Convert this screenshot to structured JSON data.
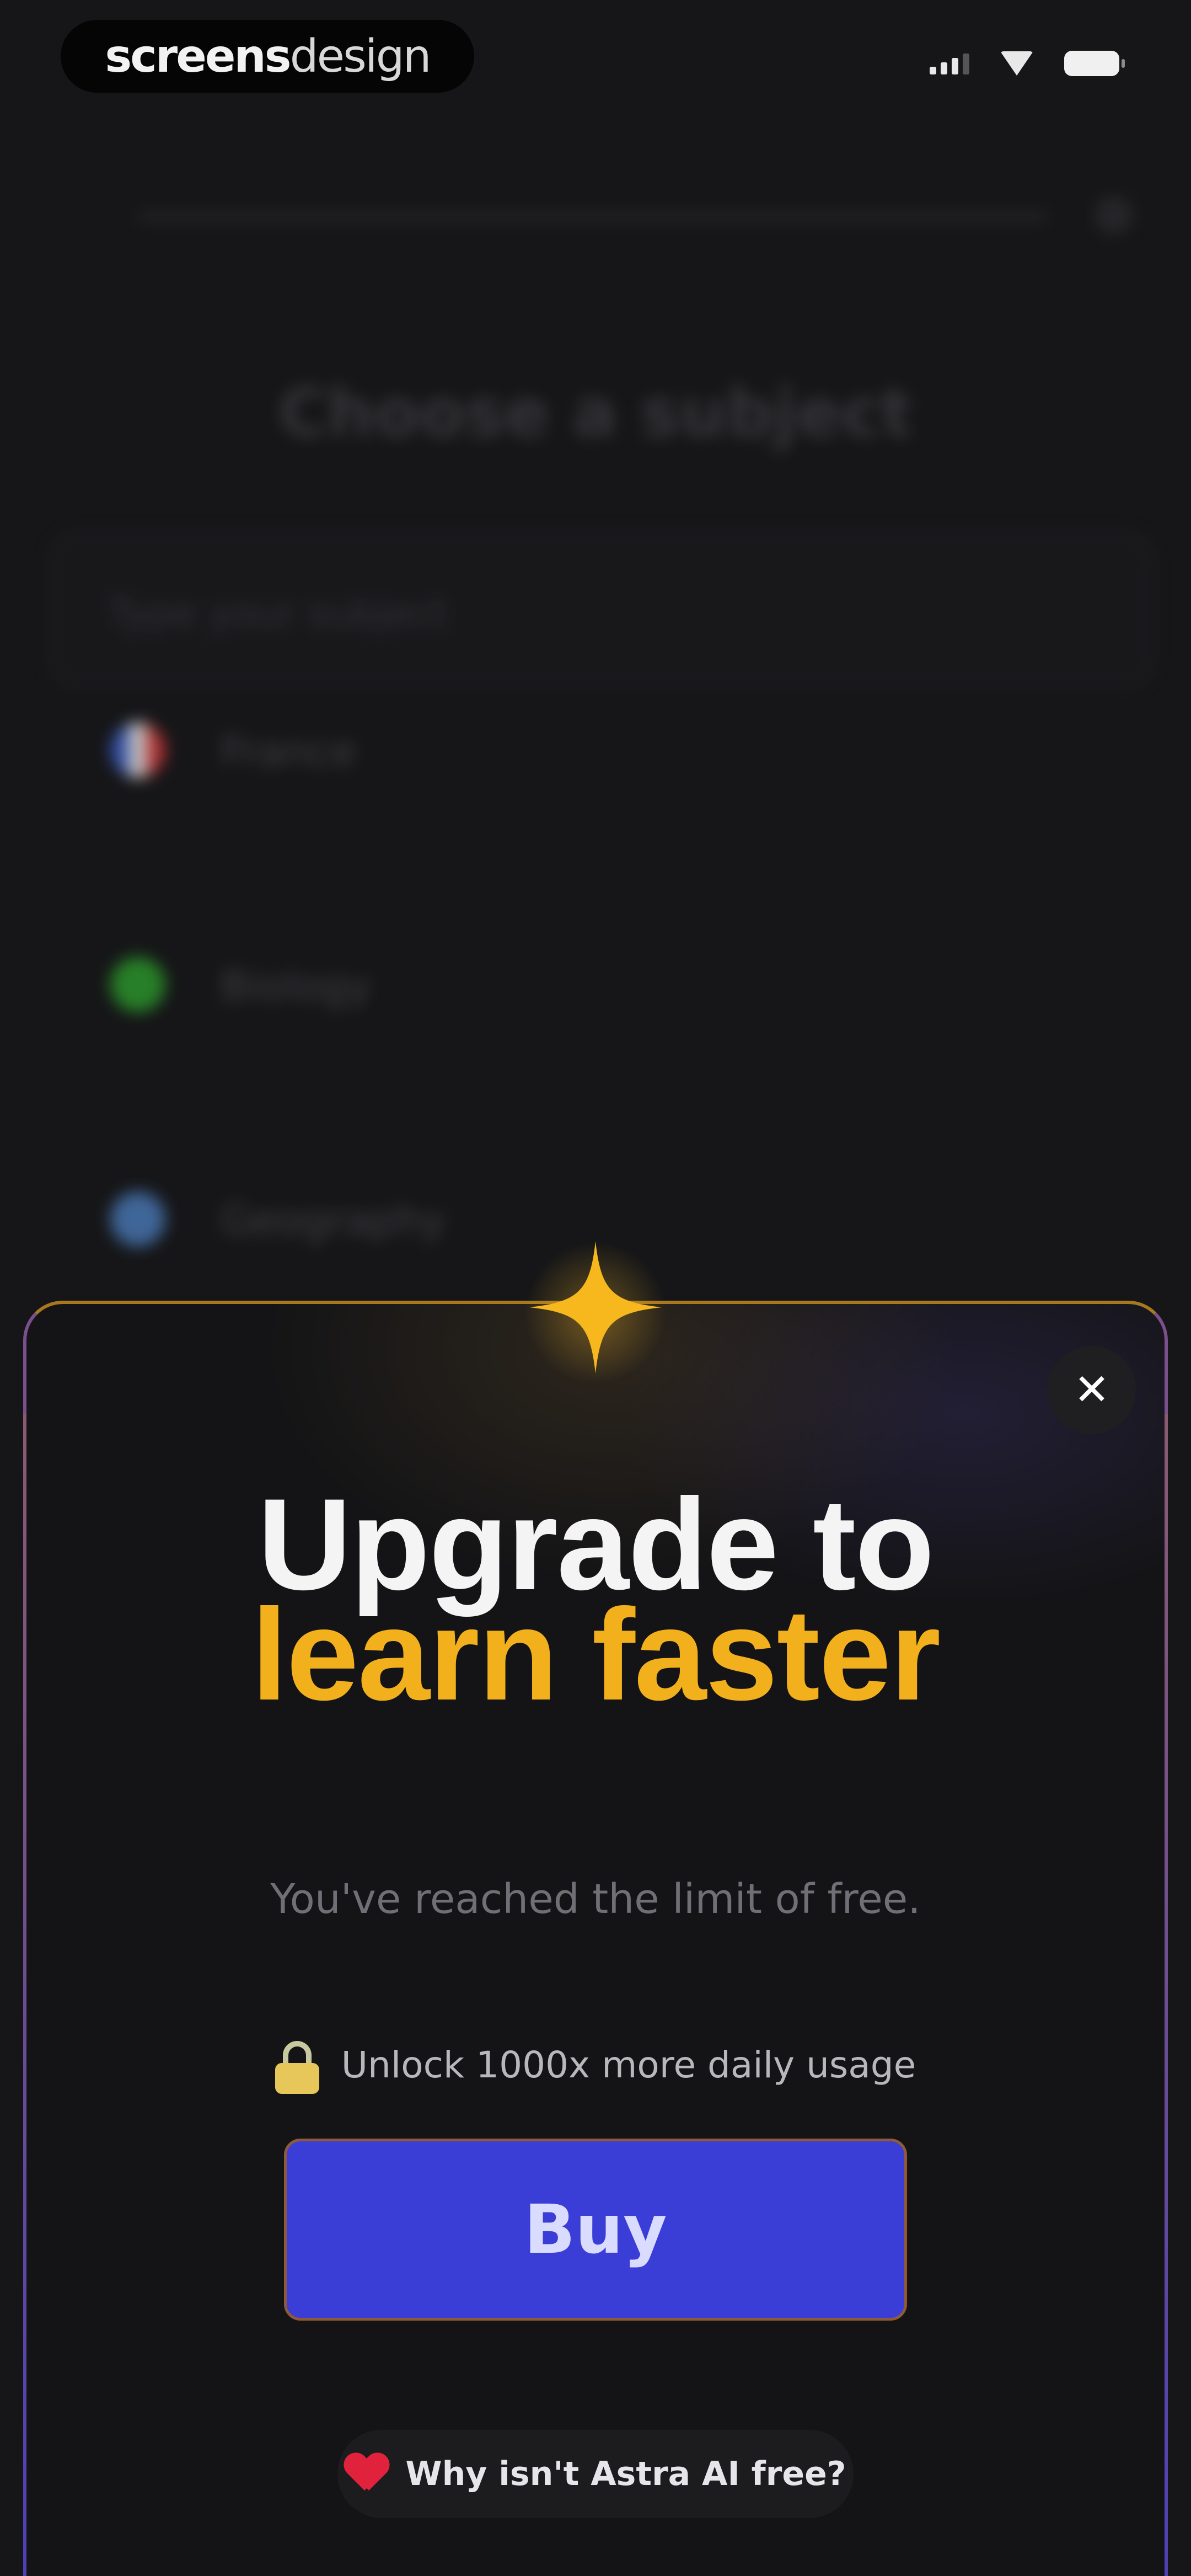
{
  "status_bar": {
    "brand_bold": "screens",
    "brand_light": "design",
    "icons": [
      "cellular-signal-icon",
      "wifi-icon",
      "battery-icon"
    ]
  },
  "background_page": {
    "title": "Choose a subject",
    "search_placeholder": "Type your subject",
    "subjects": [
      {
        "label": "France",
        "icon": "france-flag-icon"
      },
      {
        "label": "Biology",
        "icon": "biology-icon"
      },
      {
        "label": "Geography",
        "icon": "globe-icon"
      }
    ]
  },
  "modal": {
    "close_label": "✕",
    "headline_line1": "Upgrade to",
    "headline_line2": "learn faster",
    "subtitle": "You've reached the limit of free.",
    "unlock_text": "Unlock 1000x more daily usage",
    "buy_label": "Buy",
    "why_label": "Why isn't Astra AI free?",
    "colors": {
      "accent_gold": "#f2b11c",
      "button_blue": "#3a3ed6",
      "heart_red": "#e0223c"
    }
  }
}
